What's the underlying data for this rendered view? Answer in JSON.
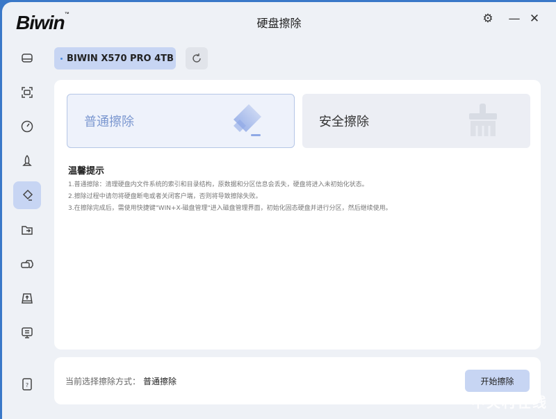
{
  "app": {
    "logo": "Biwin",
    "tm": "™",
    "title": "硬盘擦除"
  },
  "window_controls": {
    "settings": "⚙",
    "minimize": "—",
    "close": "✕"
  },
  "sidebar": {
    "items": [
      "disk",
      "scan",
      "speed",
      "boost",
      "erase",
      "migrate",
      "clone",
      "upgrade",
      "info"
    ],
    "active": "erase",
    "help": "help"
  },
  "drive": {
    "selected": "BIWIN X570 PRO 4TB"
  },
  "modes": [
    {
      "label": "普通擦除",
      "selected": true
    },
    {
      "label": "安全擦除",
      "selected": false
    }
  ],
  "tips": {
    "title": "温馨提示",
    "lines": [
      "1.普通擦除：清理硬盘内文件系统的索引和目录结构，原数据和分区信息会丢失，硬盘将进入未初始化状态。",
      "2.擦除过程中请勿将硬盘断电或者关闭客户端，否则将导致擦除失败。",
      "3.在擦除完成后，需使用快捷键\"WIN+X-磁盘管理\"进入磁盘管理界面，初始化固态硬盘并进行分区，然后继续使用。"
    ]
  },
  "footer": {
    "label": "当前选择擦除方式：",
    "value": "普通擦除",
    "start_button": "开始擦除"
  },
  "watermark": "中关村在线"
}
